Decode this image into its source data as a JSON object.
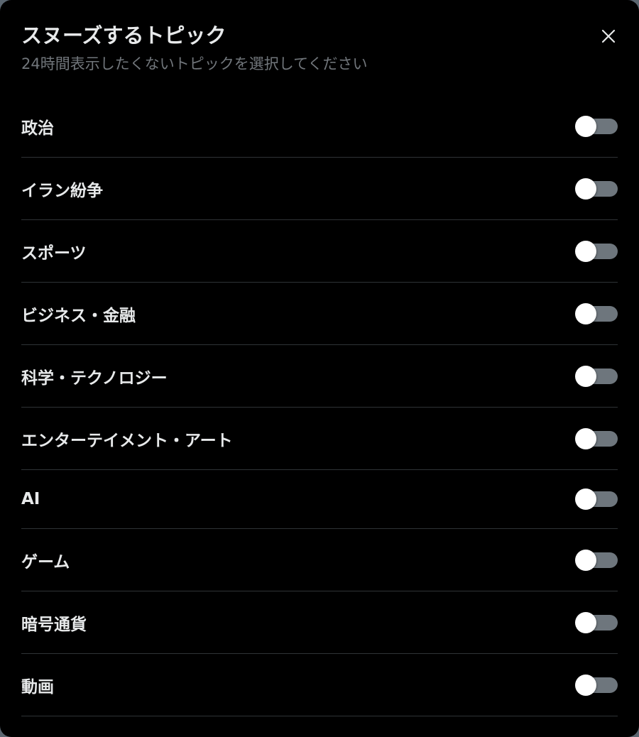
{
  "dialog": {
    "title": "スヌーズするトピック",
    "subtitle": "24時間表示したくないトピックを選択してください",
    "close_icon": "close-icon"
  },
  "topics": [
    {
      "label": "政治",
      "enabled": false
    },
    {
      "label": "イラン紛争",
      "enabled": false
    },
    {
      "label": "スポーツ",
      "enabled": false
    },
    {
      "label": "ビジネス・金融",
      "enabled": false
    },
    {
      "label": "科学・テクノロジー",
      "enabled": false
    },
    {
      "label": "エンターテイメント・アート",
      "enabled": false
    },
    {
      "label": "AI",
      "enabled": false
    },
    {
      "label": "ゲーム",
      "enabled": false
    },
    {
      "label": "暗号通貨",
      "enabled": false
    },
    {
      "label": "動画",
      "enabled": false
    }
  ],
  "colors": {
    "background": "#000000",
    "text": "#e7e9ea",
    "subtitle": "#71767b",
    "divider": "#2f3336",
    "toggle_track_off": "#6e767d",
    "toggle_knob": "#ffffff"
  }
}
